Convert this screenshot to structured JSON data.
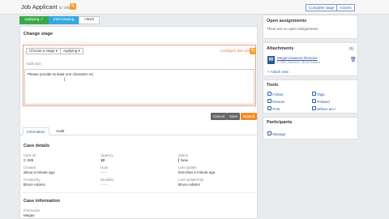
{
  "header": {
    "title": "Job Applicant",
    "case_id": "(C-285)",
    "complete_stage": "Complete stage",
    "actions": "Actions"
  },
  "stages": {
    "applying": "Applying ✓",
    "interviewing": "Interviewing",
    "hired": "Hired"
  },
  "change_stage": {
    "title": "Change stage",
    "choose_stage": "Choose a stage",
    "stage_value": "Applying",
    "configure": "Configure this view",
    "audit_label": "Audit note",
    "audit_text": "Please provide at least one character re",
    "cancel": "Cancel",
    "save": "Save",
    "submit": "Submit"
  },
  "tabs": [
    "Information",
    "Audit"
  ],
  "case_details": {
    "title": "Case details",
    "fields": {
      "case_id_l": "Case ID",
      "case_id_v": "C-285",
      "urgency_l": "Urgency",
      "urgency_v": "10",
      "status_l": "Status",
      "status_v": "New",
      "created_l": "Created",
      "created_v": "about a minute ago",
      "goal_l": "Goal",
      "goal_v": "------",
      "updated_l": "Last Update",
      "updated_v": "less than a minute ago",
      "createdby_l": "Created by",
      "createdby_v": "Bruce Adams",
      "deadline_l": "Deadline",
      "deadline_v": "------",
      "updatedby_l": "Last Updated By",
      "updatedby_v": "Bruce Adams"
    }
  },
  "case_info": {
    "title": "Case information",
    "first_name_l": "First Name",
    "first_name_v": "Megan"
  },
  "sidebar": {
    "open_assignments": "Open assignments",
    "no_assignments": "There are no open assignments",
    "attachments": "Attachments",
    "attachments_count": "(1)",
    "file_name": "Megan-Dawson-Resume",
    "file_meta": "C-285 | Resume | Bruce Adams",
    "attach_new": "Attach new",
    "tools": "Tools",
    "follow": "Follow",
    "tags": "Tags",
    "review": "Review",
    "related": "Related",
    "print": "Print",
    "where_am_i": "Where am I",
    "participants": "Participants",
    "manage": "Manage"
  },
  "colors": {
    "stage_done": "#39a84b",
    "stage_current": "#35a8e0",
    "submit": "#f08c2a",
    "link": "#2a5ea8"
  }
}
